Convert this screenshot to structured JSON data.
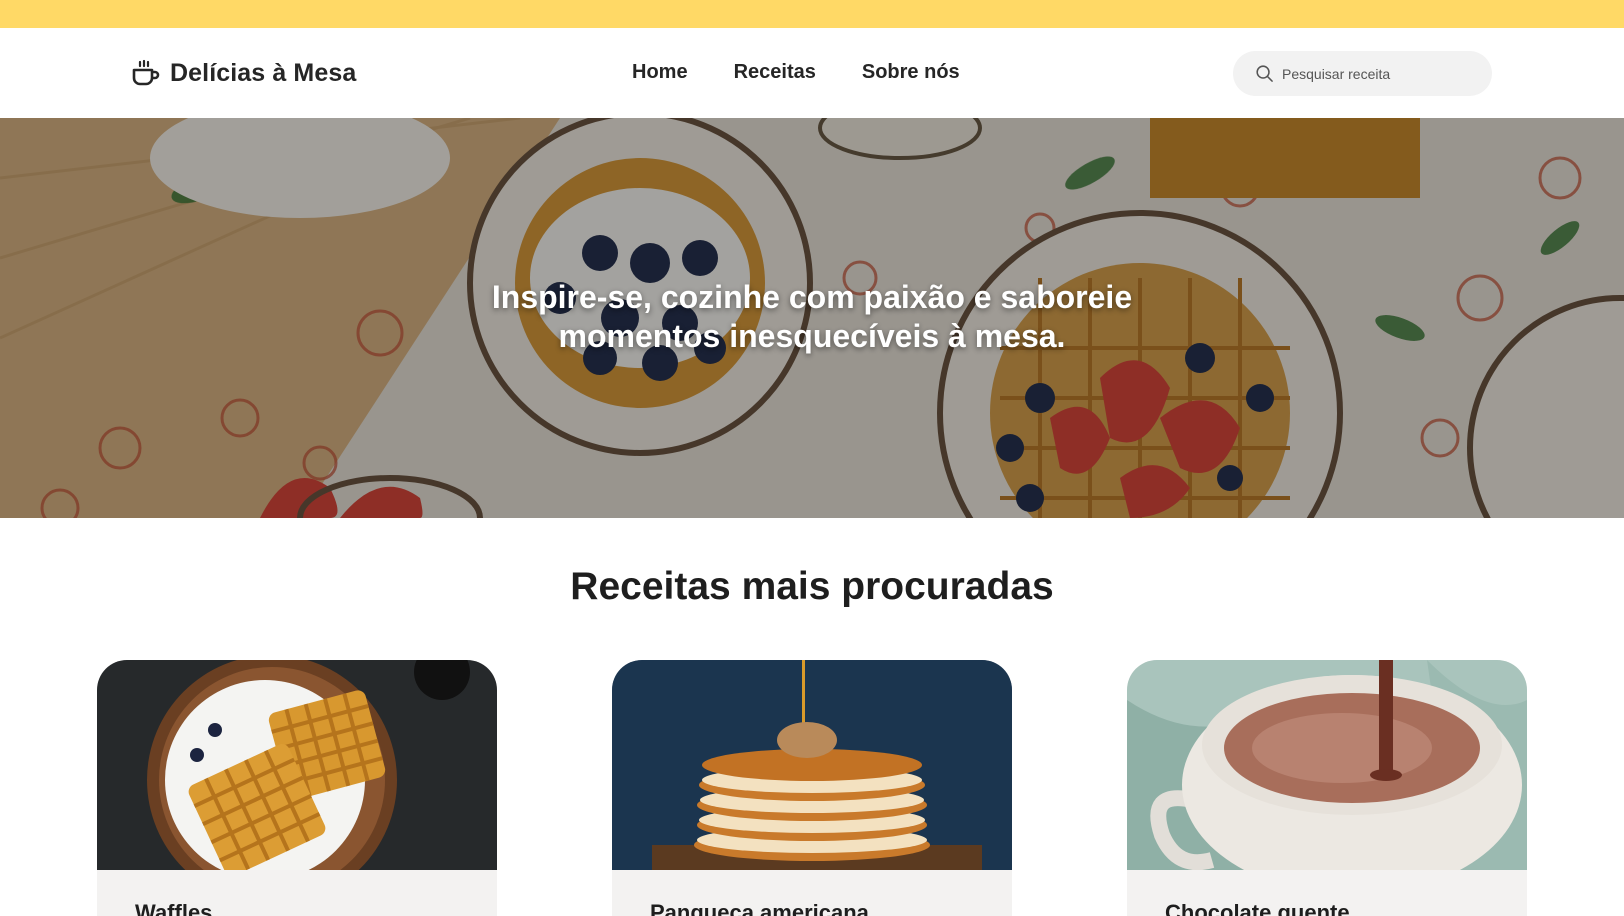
{
  "colors": {
    "topbar": "#ffd966",
    "text": "#1e1e1e",
    "search_bg": "#f2f2f2",
    "card_bg": "#f3f2f1"
  },
  "header": {
    "brand": {
      "icon": "coffee-cup-icon",
      "name": "Delícias à Mesa"
    },
    "nav": [
      {
        "label": "Home"
      },
      {
        "label": "Receitas"
      },
      {
        "label": "Sobre nós"
      }
    ],
    "search": {
      "icon": "search-icon",
      "placeholder": "Pesquisar receita",
      "value": ""
    }
  },
  "hero": {
    "headline_line1": "Inspire-se, cozinhe com paixão e saboreie",
    "headline_line2": "momentos inesquecíveis à mesa."
  },
  "popular": {
    "title": "Receitas mais procuradas",
    "cards": [
      {
        "title": "Waffles"
      },
      {
        "title": "Panqueca americana"
      },
      {
        "title": "Chocolate quente"
      }
    ]
  }
}
